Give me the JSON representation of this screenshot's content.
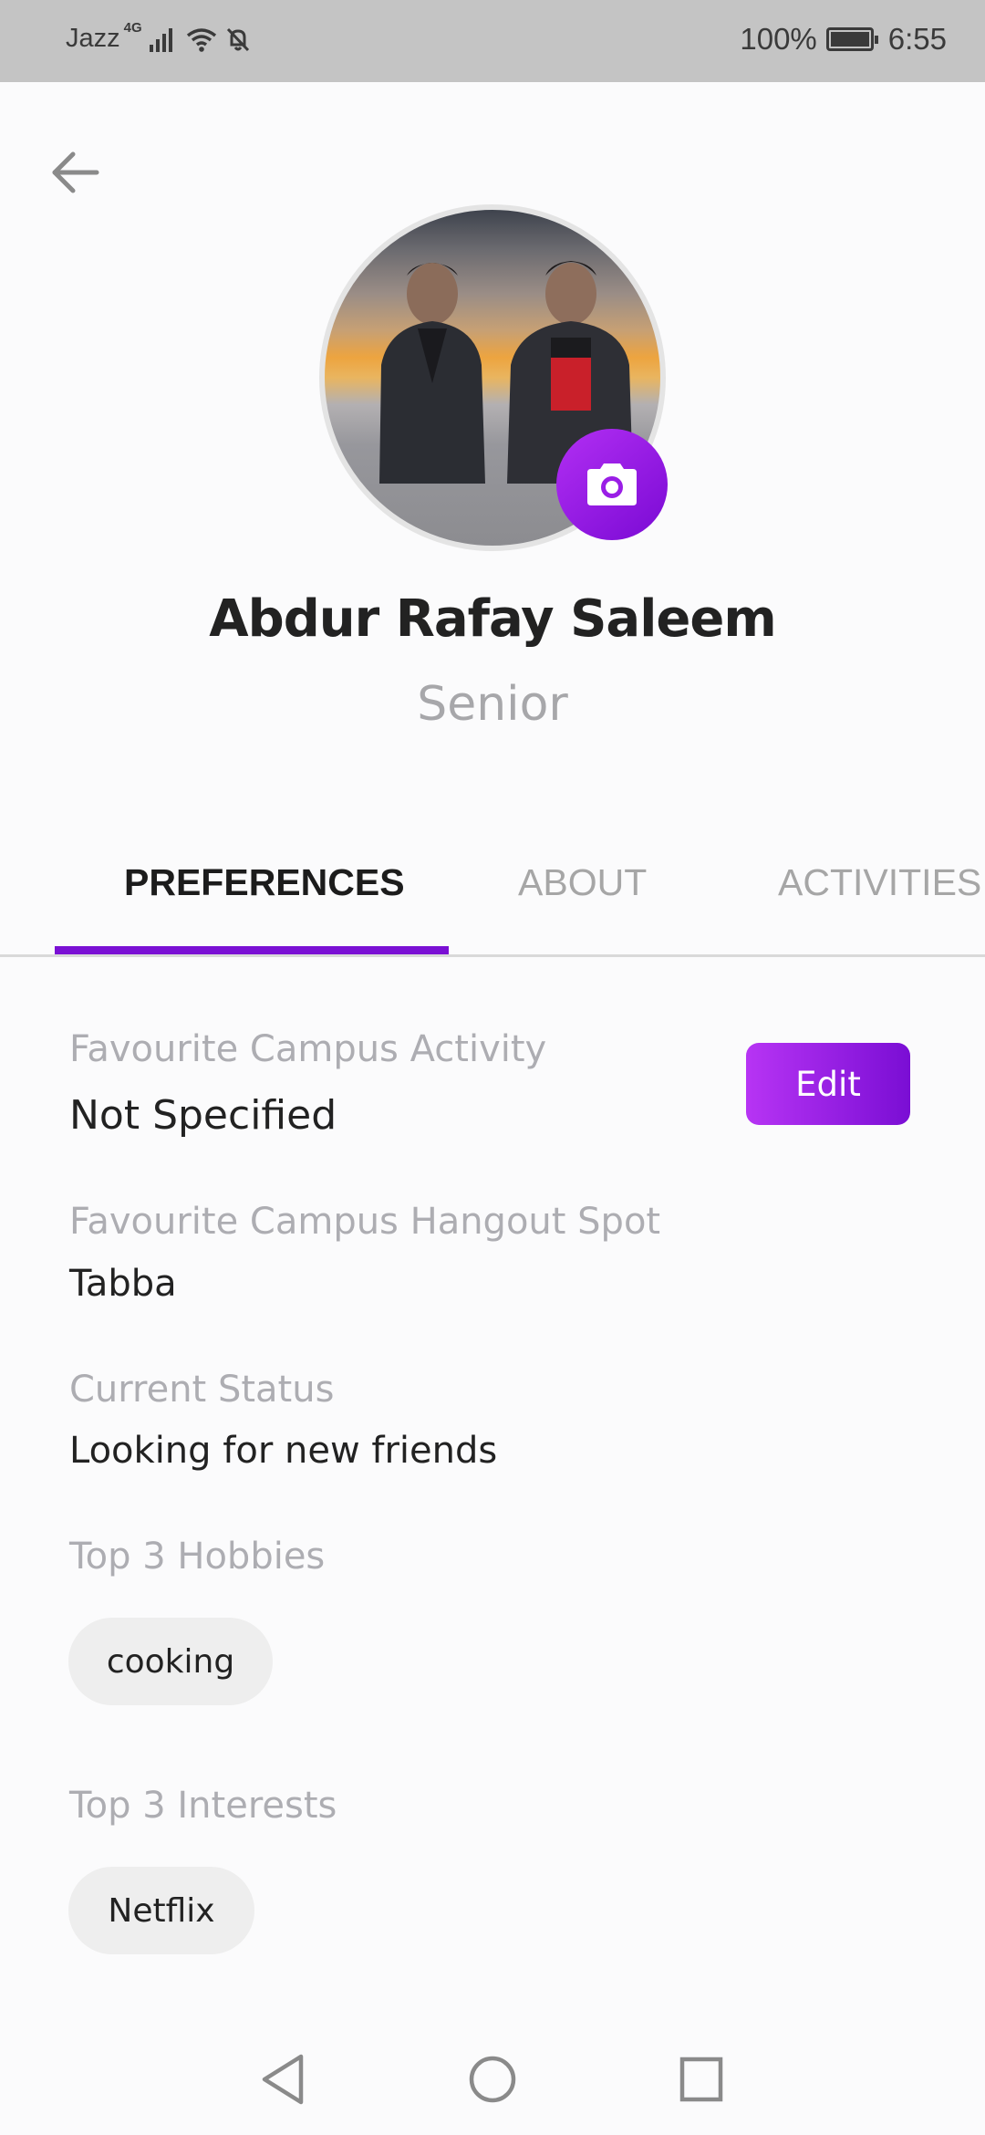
{
  "status_bar": {
    "carrier": "Jazz",
    "network": "4G",
    "battery_percent": "100%",
    "time": "6:55"
  },
  "icons": {
    "back": "arrow-left-icon",
    "camera": "camera-icon",
    "signal": "signal-icon",
    "wifi": "wifi-icon",
    "mute": "bell-off-icon",
    "battery": "battery-icon"
  },
  "profile": {
    "name": "Abdur Rafay Saleem",
    "role": "Senior"
  },
  "tabs": [
    {
      "label": "PREFERENCES",
      "active": true
    },
    {
      "label": "ABOUT",
      "active": false
    },
    {
      "label": "ACTIVITIES",
      "active": false
    }
  ],
  "preferences": {
    "activity_label": "Favourite Campus Activity",
    "activity_value": "Not Specified",
    "hangout_label": "Favourite Campus Hangout Spot",
    "hangout_value": "Tabba",
    "status_label": "Current Status",
    "status_value": "Looking for new friends",
    "hobbies_label": "Top 3 Hobbies",
    "hobbies": [
      "cooking"
    ],
    "interests_label": "Top 3 Interests",
    "interests": [
      "Netflix"
    ],
    "edit_label": "Edit"
  },
  "colors": {
    "accent": "#7a10d4",
    "accent_light": "#b734f4",
    "status_bar": "#c4c4c4"
  }
}
